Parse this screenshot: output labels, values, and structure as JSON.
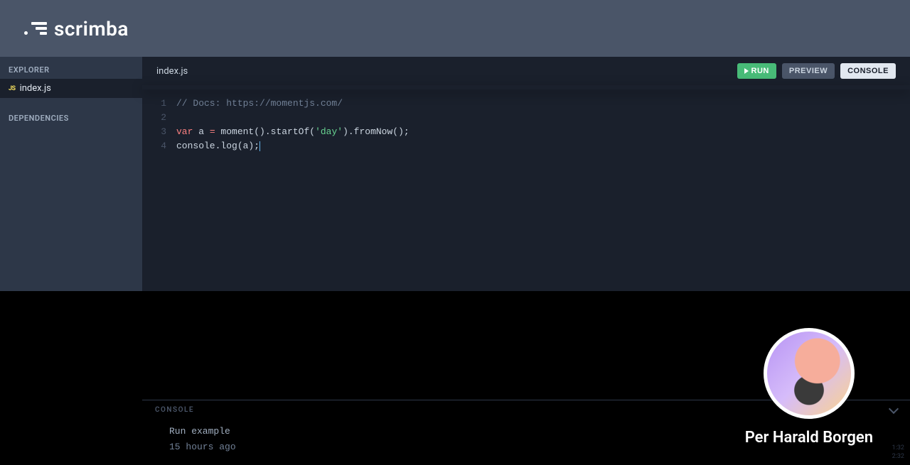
{
  "brand": {
    "name": "scrimba"
  },
  "sidebar": {
    "explorer_label": "EXPLORER",
    "dependencies_label": "DEPENDENCIES",
    "files": [
      {
        "icon": "JS",
        "name": "index.js"
      }
    ]
  },
  "editor": {
    "tab": "index.js",
    "buttons": {
      "run": "RUN",
      "preview": "PREVIEW",
      "console": "CONSOLE"
    },
    "lines": [
      {
        "n": "1",
        "comment": "// Docs: https://momentjs.com/"
      },
      {
        "n": "2"
      },
      {
        "n": "3",
        "kw": "var",
        "ident": " a ",
        "eq": "=",
        "rest1": " moment().startOf(",
        "str": "'day'",
        "rest2": ").fromNow();"
      },
      {
        "n": "4",
        "plain": "console.log(a);"
      }
    ]
  },
  "console": {
    "label": "CONSOLE",
    "out1": "Run example",
    "out2": "15 hours ago"
  },
  "instructor": {
    "name": "Per Harald Borgen"
  },
  "timestamps": {
    "a": "1:32",
    "b": "2:32"
  }
}
